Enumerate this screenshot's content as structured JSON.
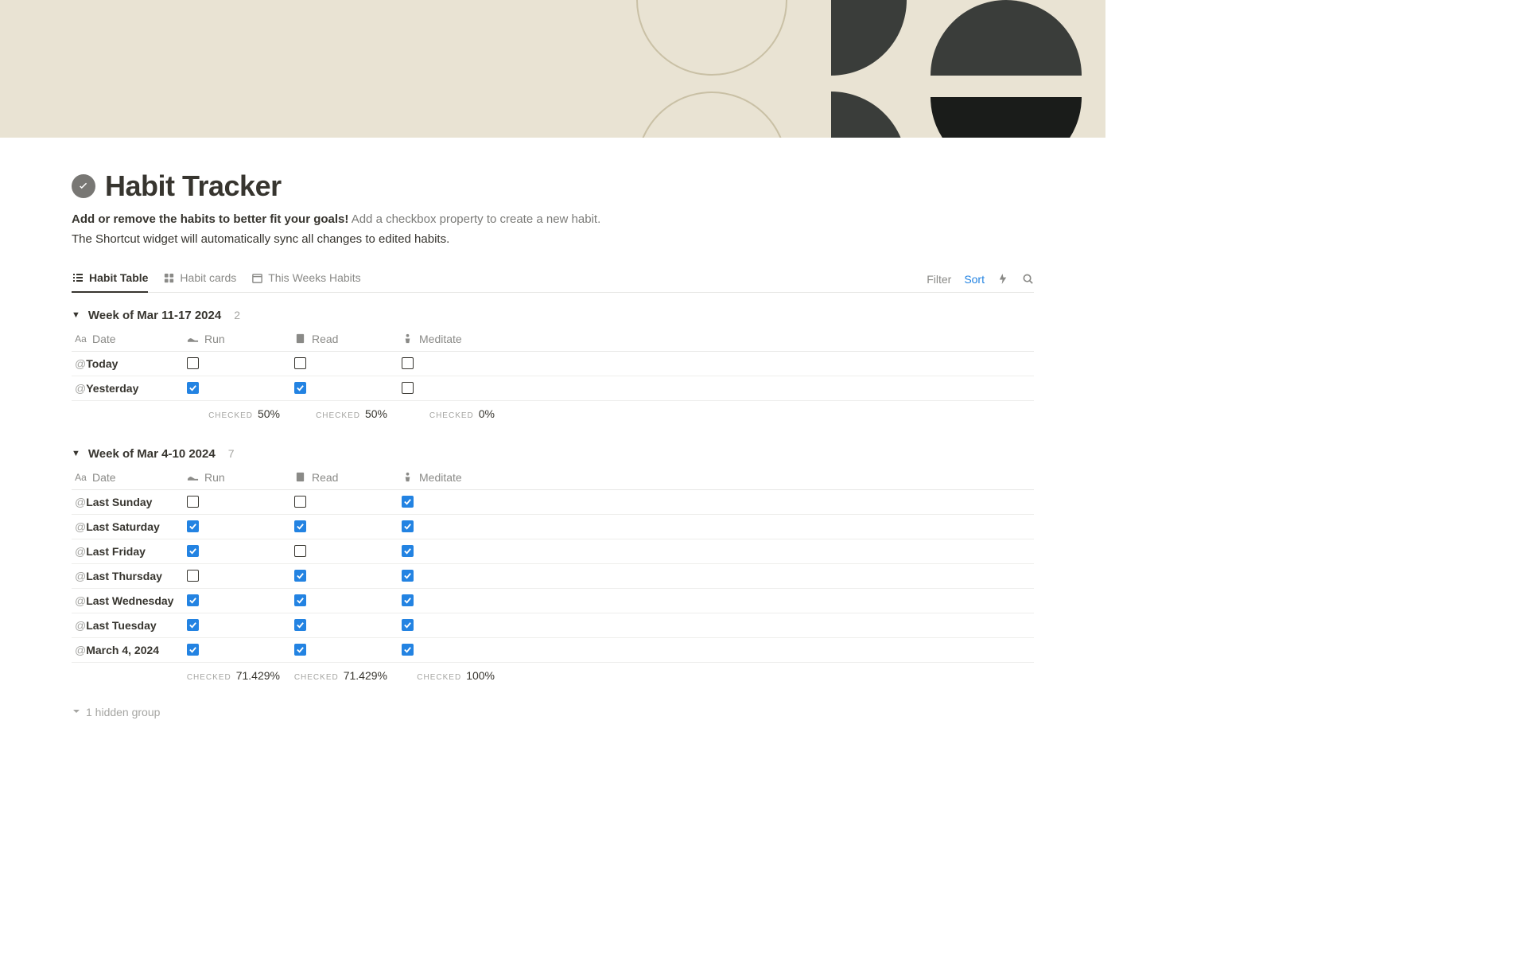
{
  "page": {
    "title": "Habit Tracker",
    "subtitle_bold": "Add or remove the habits to better fit your goals!",
    "subtitle_rest": " Add a checkbox property to create a new habit.",
    "subtitle_line2": "The Shortcut widget will automatically sync all changes to edited habits."
  },
  "tabs": {
    "habit_table": "Habit Table",
    "habit_cards": "Habit cards",
    "this_week": "This Weeks Habits"
  },
  "controls": {
    "filter": "Filter",
    "sort": "Sort"
  },
  "columns": {
    "date": "Date",
    "run": "Run",
    "read": "Read",
    "meditate": "Meditate"
  },
  "summary_label": "Checked",
  "groups": [
    {
      "title": "Week of Mar 11-17 2024",
      "count": "2",
      "rows": [
        {
          "date": "Today",
          "run": false,
          "read": false,
          "meditate": false
        },
        {
          "date": "Yesterday",
          "run": true,
          "read": true,
          "meditate": false
        }
      ],
      "summary": {
        "run": "50%",
        "read": "50%",
        "meditate": "0%"
      }
    },
    {
      "title": "Week of Mar 4-10 2024",
      "count": "7",
      "rows": [
        {
          "date": "Last Sunday",
          "run": false,
          "read": false,
          "meditate": true
        },
        {
          "date": "Last Saturday",
          "run": true,
          "read": true,
          "meditate": true
        },
        {
          "date": "Last Friday",
          "run": true,
          "read": false,
          "meditate": true
        },
        {
          "date": "Last Thursday",
          "run": false,
          "read": true,
          "meditate": true
        },
        {
          "date": "Last Wednesday",
          "run": true,
          "read": true,
          "meditate": true
        },
        {
          "date": "Last Tuesday",
          "run": true,
          "read": true,
          "meditate": true
        },
        {
          "date": "March 4, 2024",
          "run": true,
          "read": true,
          "meditate": true
        }
      ],
      "summary": {
        "run": "71.429%",
        "read": "71.429%",
        "meditate": "100%"
      }
    }
  ],
  "hidden_groups": "1 hidden group"
}
